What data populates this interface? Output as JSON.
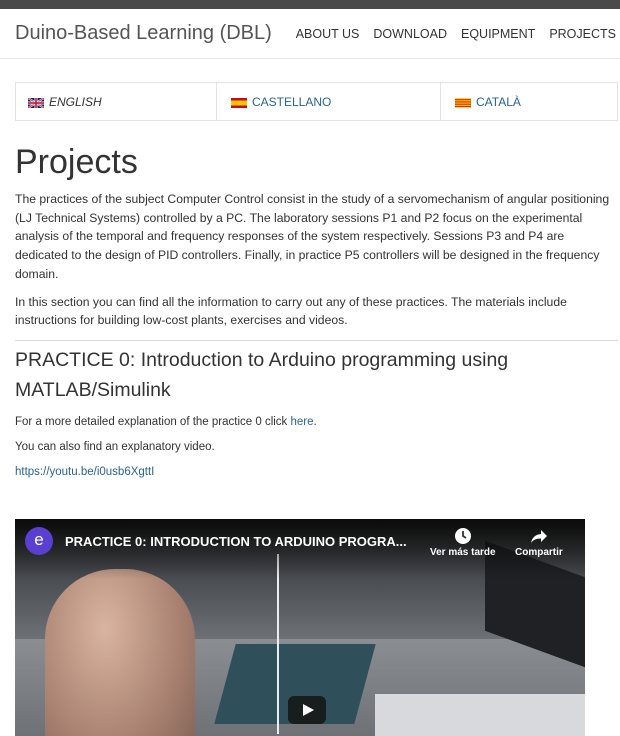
{
  "site": {
    "brand": "Duino-Based Learning (DBL)"
  },
  "nav": {
    "items": [
      "ABOUT US",
      "DOWNLOAD",
      "EQUIPMENT",
      "PROJECTS"
    ]
  },
  "languages": [
    {
      "label": "ENGLISH",
      "flag": "uk-flag-icon"
    },
    {
      "label": "CASTELLANO",
      "flag": "spain-flag-icon"
    },
    {
      "label": "CATALÀ",
      "flag": "catalonia-flag-icon"
    }
  ],
  "page": {
    "title": "Projects",
    "intro": "The practices of the subject Computer Control consist in the study of a servomechanism of angular positioning (LJ Technical Systems) controlled by a PC. The laboratory sessions P1 and P2 focus on the experimental analysis of the temporal and frequency responses of the system respectively. Sessions P3 and P4 are dedicated to the design of PID controllers. Finally, in practice P5 controllers will be designed in the frequency domain.",
    "intro2": "In this section you can find all the information to carry out any of these practices. The materials include instructions for building low-cost plants, exercises and videos."
  },
  "section": {
    "title": "PRACTICE 0: Introduction to Arduino programming using MATLAB/Simulink",
    "detail_prefix": "For a more detailed explanation of the practice 0 click ",
    "detail_link": "here",
    "detail_suffix": ".",
    "video_note": "You can also find an explanatory video.",
    "video_url": "https://youtu.be/i0usb6XgttI"
  },
  "video": {
    "channel_initial": "e",
    "title": "PRACTICE 0: INTRODUCTION TO ARDUINO PROGRA...",
    "watch_later": "Ver más tarde",
    "share": "Compartir"
  },
  "colors": {
    "link": "#2a6496",
    "topbar": "#4a4a4a",
    "avatar": "#5b3fd1"
  }
}
